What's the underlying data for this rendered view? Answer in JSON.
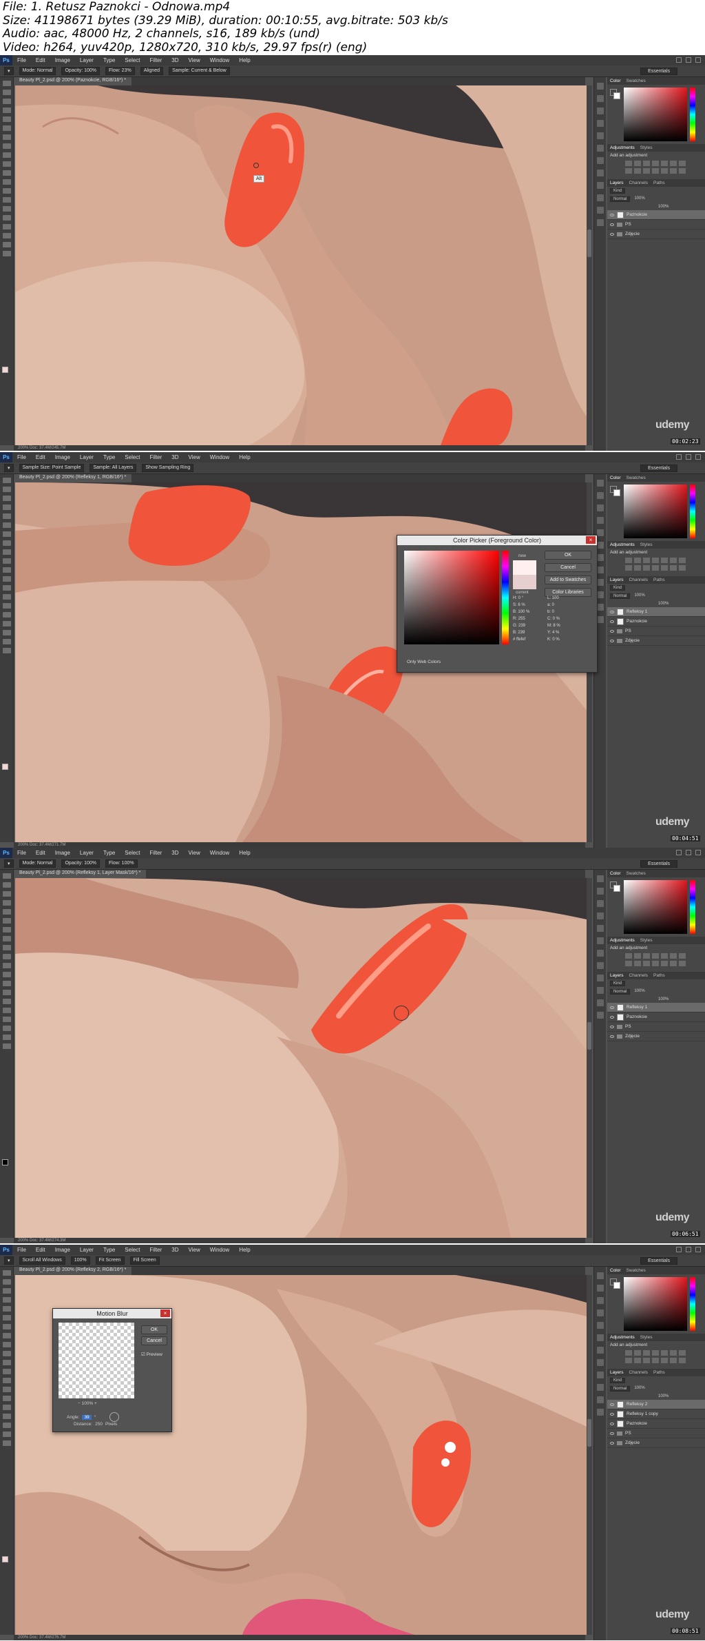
{
  "header": {
    "file": "File: 1. Retusz Paznokci - Odnowa.mp4",
    "size": "Size: 41198671 bytes (39.29 MiB), duration: 00:10:55, avg.bitrate: 503 kb/s",
    "audio": "Audio: aac, 48000 Hz, 2 channels, s16, 189 kb/s (und)",
    "video": "Video: h264, yuv420p, 1280x720, 310 kb/s, 29.97 fps(r) (eng)"
  },
  "app": {
    "logo": "Ps",
    "menus": [
      "File",
      "Edit",
      "Image",
      "Layer",
      "Type",
      "Select",
      "Filter",
      "3D",
      "View",
      "Window",
      "Help"
    ],
    "workspace": "Essentials",
    "watermark": "udemy",
    "color_tabs": [
      "Color",
      "Swatches"
    ],
    "adjust_tabs": [
      "Adjustments",
      "Styles"
    ],
    "adjust_hint": "Add an adjustment",
    "layer_tabs": [
      "Layers",
      "Channels",
      "Paths"
    ],
    "kind": "Kind",
    "blend": "Normal",
    "opacity": "100%",
    "fill": "100%"
  },
  "frames": [
    {
      "tab": "Beauty Pl_2.psd @ 200% (Paznokcie, RGB/16*) *",
      "options": [
        "Mode: Normal",
        "Opacity: 100%",
        "Flow: 23%",
        "Aligned",
        "Sample: Current & Below"
      ],
      "status": "200%     Doc: 37.4M/245.7M",
      "timecode": "00:02:23",
      "tooltip": "Alt",
      "layers": [
        {
          "name": "Paznokcie",
          "type": "layer",
          "selected": true
        },
        {
          "name": "PS",
          "type": "group",
          "selected": false
        },
        {
          "name": "Zdjęcie",
          "type": "group",
          "selected": false
        }
      ]
    },
    {
      "tab": "Beauty Pl_2.psd @ 200% (Refleksy 1, RGB/16*) *",
      "options": [
        "Sample Size: Point Sample",
        "Sample: All Layers",
        "Show Sampling Ring"
      ],
      "status": "200%     Doc: 37.4M/271.7M",
      "timecode": "00:04:51",
      "layers": [
        {
          "name": "Refleksy 1",
          "type": "layer",
          "selected": true
        },
        {
          "name": "Paznokcie",
          "type": "layer",
          "selected": false
        },
        {
          "name": "PS",
          "type": "group",
          "selected": false
        },
        {
          "name": "Zdjęcie",
          "type": "group",
          "selected": false
        }
      ],
      "dialog": {
        "title": "Color Picker (Foreground Color)",
        "buttons": [
          "OK",
          "Cancel",
          "Add to Swatches",
          "Color Libraries"
        ],
        "new_label": "new",
        "current_label": "current",
        "only_web": "Only Web Colors",
        "hsb": [
          "H: 0 °",
          "S: 6 %",
          "B: 100 %"
        ],
        "rgb": [
          "R: 255",
          "G: 239",
          "B: 239"
        ],
        "lab": [
          "L: 100",
          "a: 0",
          "b: 0"
        ],
        "cmyk": [
          "C: 0 %",
          "M: 8 %",
          "Y: 4 %",
          "K: 0 %"
        ],
        "hex": "# ffefef"
      }
    },
    {
      "tab": "Beauty Pl_2.psd @ 200% (Refleksy 1, Layer Mask/16*) *",
      "options": [
        "Mode: Normal",
        "Opacity: 100%",
        "Flow: 100%"
      ],
      "status": "200%     Doc: 37.4M/274.3M",
      "timecode": "00:06:51",
      "layers": [
        {
          "name": "Refleksy 1",
          "type": "layer",
          "selected": true
        },
        {
          "name": "Paznokcie",
          "type": "layer",
          "selected": false
        },
        {
          "name": "PS",
          "type": "group",
          "selected": false
        },
        {
          "name": "Zdjęcie",
          "type": "group",
          "selected": false
        }
      ]
    },
    {
      "tab": "Beauty Pl_2.psd @ 200% (Refleksy 2, RGB/16*) *",
      "options": [
        "Scroll All Windows",
        "100%",
        "Fit Screen",
        "Fill Screen"
      ],
      "status": "200%     Doc: 37.4M/276.7M",
      "timecode": "00:08:51",
      "layers": [
        {
          "name": "Refleksy 2",
          "type": "layer",
          "selected": true
        },
        {
          "name": "Refleksy 1 copy",
          "type": "layer",
          "selected": false
        },
        {
          "name": "Paznokcie",
          "type": "layer",
          "selected": false
        },
        {
          "name": "PS",
          "type": "group",
          "selected": false
        },
        {
          "name": "Zdjęcie",
          "type": "group",
          "selected": false
        }
      ],
      "dialog": {
        "title": "Motion Blur",
        "buttons": [
          "OK",
          "Cancel"
        ],
        "preview": "Preview",
        "zoom": "100%",
        "angle_label": "Angle:",
        "angle_value": "39",
        "distance_label": "Distance:",
        "distance_value": "250",
        "distance_unit": "Pixels"
      }
    }
  ]
}
